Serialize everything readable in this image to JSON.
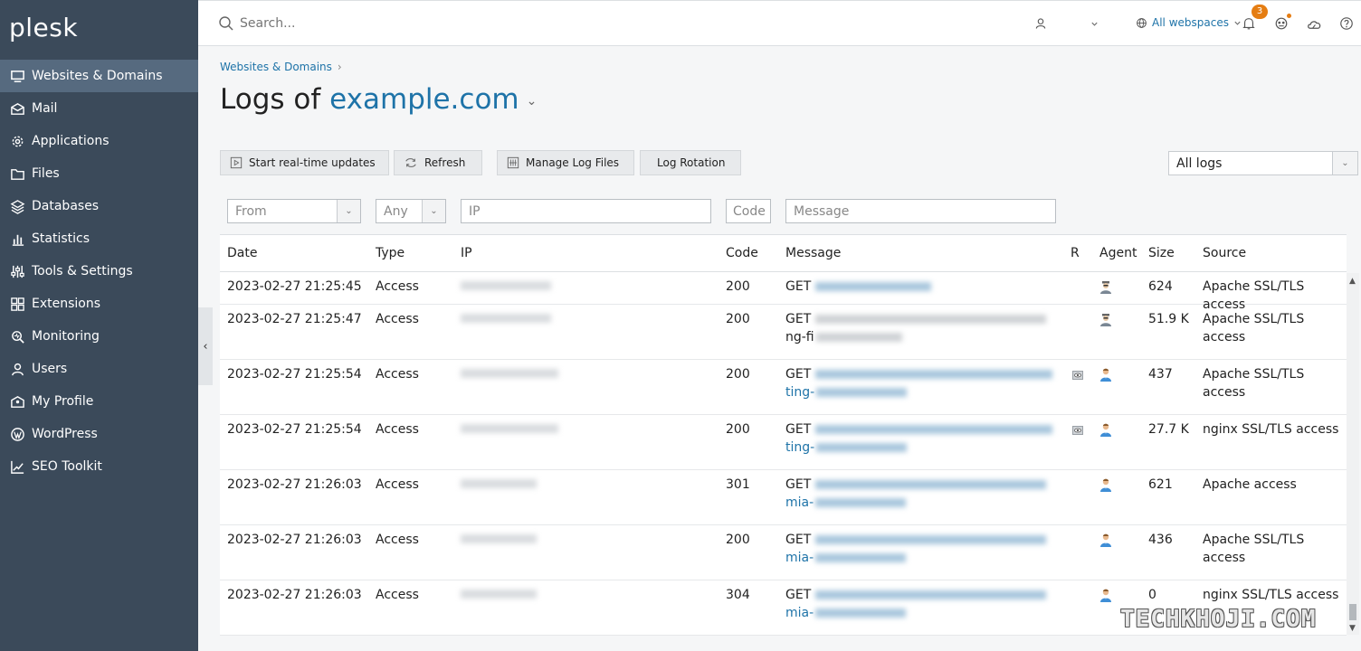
{
  "sidebar": {
    "logo": "plesk",
    "items": [
      {
        "label": "Websites & Domains",
        "icon": "monitor-icon",
        "active": true
      },
      {
        "label": "Mail",
        "icon": "envelope-icon"
      },
      {
        "label": "Applications",
        "icon": "gear-icon"
      },
      {
        "label": "Files",
        "icon": "folder-icon"
      },
      {
        "label": "Databases",
        "icon": "layers-icon"
      },
      {
        "label": "Statistics",
        "icon": "bar-chart-icon"
      },
      {
        "label": "Tools & Settings",
        "icon": "sliders-icon"
      },
      {
        "label": "Extensions",
        "icon": "grid-icon"
      },
      {
        "label": "Monitoring",
        "icon": "magnifier-icon"
      },
      {
        "label": "Users",
        "icon": "user-icon"
      },
      {
        "label": "My Profile",
        "icon": "id-card-icon"
      },
      {
        "label": "WordPress",
        "icon": "wordpress-icon"
      },
      {
        "label": "SEO Toolkit",
        "icon": "trend-chart-icon"
      }
    ]
  },
  "header": {
    "search_placeholder": "Search...",
    "webspaces_label": "All webspaces",
    "notifications_count": "3"
  },
  "breadcrumb": {
    "item": "Websites & Domains"
  },
  "title": {
    "prefix": "Logs of",
    "domain": "example.com"
  },
  "toolbar": {
    "realtime": "Start real-time updates",
    "refresh": "Refresh",
    "manage": "Manage Log Files",
    "rotation": "Log Rotation",
    "log_select": "All logs"
  },
  "filters": {
    "from": "From",
    "type": "Any",
    "ip": "IP",
    "code": "Code",
    "message": "Message"
  },
  "table": {
    "headers": {
      "date": "Date",
      "type": "Type",
      "ip": "IP",
      "code": "Code",
      "message": "Message",
      "r": "R",
      "agent": "Agent",
      "size": "Size",
      "source": "Source"
    },
    "rows": [
      {
        "date": "2023-02-27 21:25:45",
        "type": "Access",
        "code": "200",
        "method": "GET",
        "size": "624",
        "source": "Apache SSL/TLS access",
        "agent": "bot",
        "referrer": false,
        "link_line2": ""
      },
      {
        "date": "2023-02-27 21:25:47",
        "type": "Access",
        "code": "200",
        "method": "GET",
        "size": "51.9 K",
        "source": "Apache SSL/TLS access",
        "agent": "bot",
        "referrer": false,
        "link_line2": "",
        "text_line2": "ng-fi"
      },
      {
        "date": "2023-02-27 21:25:54",
        "type": "Access",
        "code": "200",
        "method": "GET",
        "size": "437",
        "source": "Apache SSL/TLS access",
        "agent": "user",
        "referrer": true,
        "link_line2": "ting-"
      },
      {
        "date": "2023-02-27 21:25:54",
        "type": "Access",
        "code": "200",
        "method": "GET",
        "size": "27.7 K",
        "source": "nginx SSL/TLS access",
        "agent": "user",
        "referrer": true,
        "link_line2": "ting-"
      },
      {
        "date": "2023-02-27 21:26:03",
        "type": "Access",
        "code": "301",
        "method": "GET",
        "size": "621",
        "source": "Apache access",
        "agent": "user",
        "referrer": false,
        "link_line2": "mia-"
      },
      {
        "date": "2023-02-27 21:26:03",
        "type": "Access",
        "code": "200",
        "method": "GET",
        "size": "436",
        "source": "Apache SSL/TLS access",
        "agent": "user",
        "referrer": false,
        "link_line2": "mia-"
      },
      {
        "date": "2023-02-27 21:26:03",
        "type": "Access",
        "code": "304",
        "method": "GET",
        "size": "0",
        "source": "nginx SSL/TLS access",
        "agent": "user",
        "referrer": false,
        "link_line2": "mia-"
      }
    ]
  },
  "watermark": "TECHKHOJI.COM",
  "colors": {
    "sidebar": "#3b4a5a",
    "sidebar_active": "#566a7f",
    "link": "#1e73a8",
    "badge": "#e57d12"
  }
}
